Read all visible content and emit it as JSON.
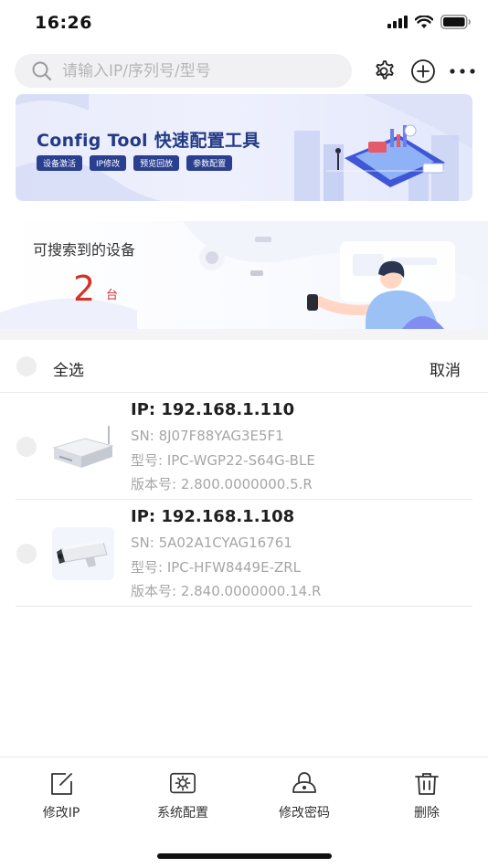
{
  "status_bar": {
    "time": "16:26"
  },
  "header": {
    "search": {
      "placeholder": "请输入IP/序列号/型号",
      "value": ""
    }
  },
  "banner": {
    "title": "Config Tool 快速配置工具",
    "tags": [
      "设备激活",
      "IP修改",
      "预览回放",
      "参数配置"
    ]
  },
  "found": {
    "label": "可搜索到的设备",
    "count": "2",
    "unit": "台"
  },
  "select_all": {
    "label": "全选",
    "cancel": "取消"
  },
  "devices": [
    {
      "ip": "IP: 192.168.1.110",
      "sn": "SN: 8J07F88YAG3E5F1",
      "model": "型号: IPC-WGP22-S64G-BLE",
      "version": "版本号: 2.800.0000000.5.R"
    },
    {
      "ip": "IP: 192.168.1.108",
      "sn": "SN: 5A02A1CYAG16761",
      "model": "型号: IPC-HFW8449E-ZRL",
      "version": "版本号: 2.840.0000000.14.R"
    }
  ],
  "toolbar": {
    "items": [
      {
        "label": "修改IP",
        "icon": "edit-icon"
      },
      {
        "label": "系统配置",
        "icon": "system-config-icon"
      },
      {
        "label": "修改密码",
        "icon": "lock-icon"
      },
      {
        "label": "删除",
        "icon": "trash-icon"
      }
    ]
  },
  "colors": {
    "accent_red": "#d6312b",
    "banner_blue": "#233a86"
  }
}
